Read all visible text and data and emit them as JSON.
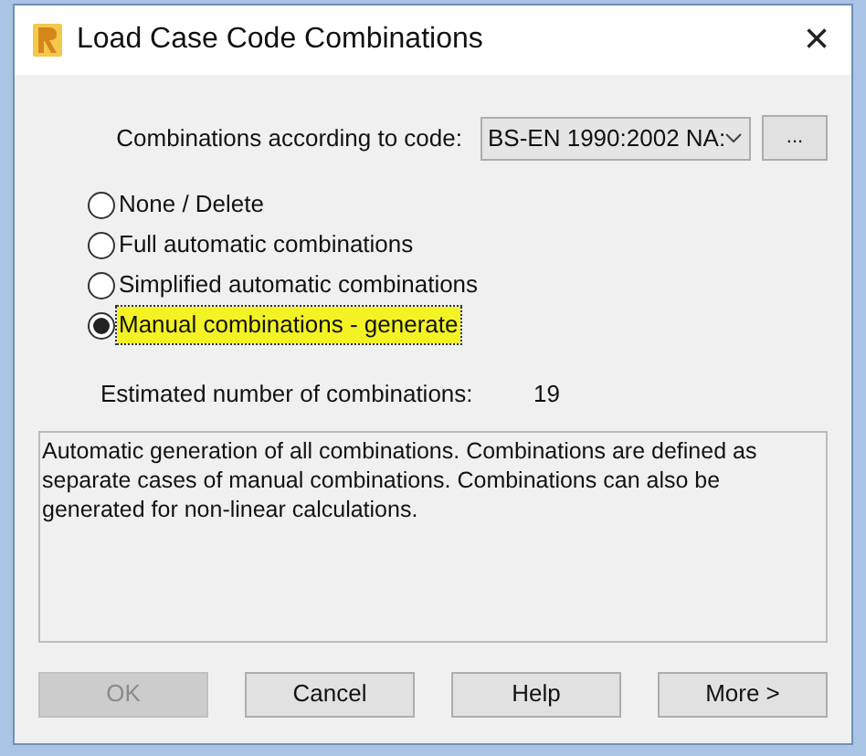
{
  "window": {
    "title": "Load Case Code Combinations",
    "close": "×"
  },
  "code": {
    "label": "Combinations according to code:",
    "value": "BS-EN 1990:2002 NA:",
    "browse": "..."
  },
  "options": [
    {
      "label": "None / Delete",
      "selected": false,
      "highlighted": false
    },
    {
      "label": "Full automatic combinations",
      "selected": false,
      "highlighted": false
    },
    {
      "label": "Simplified automatic combinations",
      "selected": false,
      "highlighted": false
    },
    {
      "label": "Manual combinations - generate",
      "selected": true,
      "highlighted": true
    }
  ],
  "estimate": {
    "label": "Estimated number of combinations:",
    "value": "19"
  },
  "description": "Automatic generation of all combinations. Combinations are defined as separate cases of manual combinations. Combinations can also be generated for non-linear calculations.",
  "buttons": [
    {
      "label": "OK",
      "disabled": true
    },
    {
      "label": "Cancel",
      "disabled": false
    },
    {
      "label": "Help",
      "disabled": false
    },
    {
      "label": "More >",
      "disabled": false
    }
  ]
}
